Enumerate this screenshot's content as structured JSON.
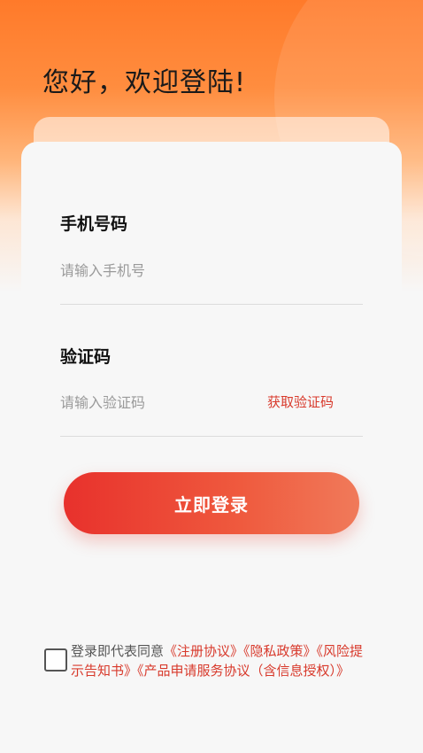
{
  "header": {
    "welcome_text": "您好，欢迎登陆!"
  },
  "form": {
    "phone": {
      "label": "手机号码",
      "placeholder": "请输入手机号",
      "value": ""
    },
    "code": {
      "label": "验证码",
      "placeholder": "请输入验证码",
      "value": "",
      "get_code_label": "获取验证码"
    },
    "login_label": "立即登录"
  },
  "agreement": {
    "checked": false,
    "prefix": "登录即代表同意",
    "links": [
      "《注册协议》",
      "《隐私政策》",
      "《风险提示告知书》",
      "《产品申请服务协议（含信息授权）》"
    ]
  },
  "colors": {
    "accent": "#e8312c",
    "link": "#d83a2c",
    "hero_orange": "#ff7a2a"
  }
}
